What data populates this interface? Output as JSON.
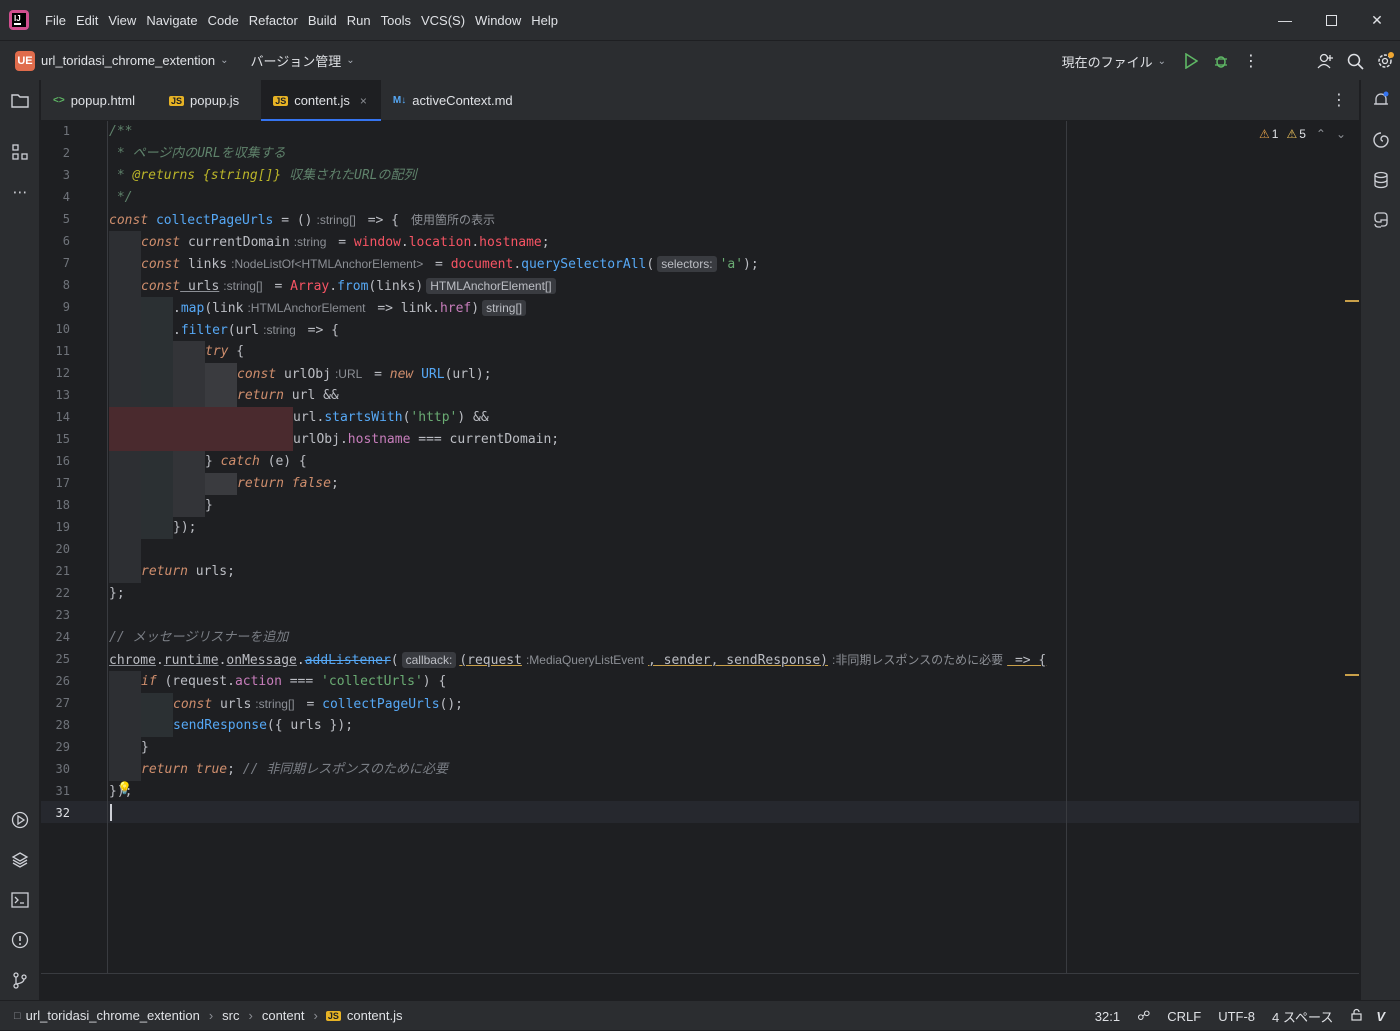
{
  "menu": [
    "File",
    "Edit",
    "View",
    "Navigate",
    "Code",
    "Refactor",
    "Build",
    "Run",
    "Tools",
    "VCS(S)",
    "Window",
    "Help"
  ],
  "toolbar": {
    "project_badge": "UE",
    "project_name": "url_toridasi_chrome_extention",
    "vcs_label": "バージョン管理",
    "run_config": "現在のファイル"
  },
  "tabs": [
    {
      "icon": "<>",
      "label": "popup.html"
    },
    {
      "icon": "JS",
      "label": "popup.js"
    },
    {
      "icon": "JS",
      "label": "content.js",
      "close": "×"
    },
    {
      "icon": "M↓",
      "label": "activeContext.md"
    }
  ],
  "inspections": {
    "errors": "1",
    "warnings": "5"
  },
  "code": {
    "l1": "/**",
    "l2": " * ページ内のURLを収集する",
    "l3_prefix": " * ",
    "l3_tag": "@returns",
    "l3_type": " {string[]}",
    "l3_text": " 収集されたURLの配列",
    "l4": " */",
    "l5_kw": "const",
    "l5_fn": "collectPageUrls",
    "l5_eq": " = ()",
    "l5_hint": ":string[]",
    "l5_arrow": " => {",
    "l5_usages": "使用箇所の表示",
    "l6_kw": "const",
    "l6_id": " currentDomain",
    "l6_hint": ":string",
    "l6_eq": " = ",
    "l6_window": "window",
    "l6_dot1": ".",
    "l6_loc": "location",
    "l6_dot2": ".",
    "l6_host": "hostname",
    "l6_end": ";",
    "l7_kw": "const",
    "l7_id": " links",
    "l7_hint": ":NodeListOf<HTMLAnchorElement>",
    "l7_eq": " = ",
    "l7_doc": "document",
    "l7_dot": ".",
    "l7_fn": "querySelectorAll",
    "l7_open": "(",
    "l7_param": "selectors:",
    "l7_arg": "'a'",
    "l7_end": ");",
    "l8_kw": "const",
    "l8_id": " urls",
    "l8_hint": ":string[]",
    "l8_eq": " = ",
    "l8_arr": "Array",
    "l8_dot": ".",
    "l8_fn": "from",
    "l8_args": "(links)",
    "l8_box": "HTMLAnchorElement[]",
    "l9_dot": ".",
    "l9_fn": "map",
    "l9_open": "(link",
    "l9_hint": ":HTMLAnchorElement",
    "l9_arrow": " => link.",
    "l9_prop": "href",
    "l9_close": ")",
    "l9_box": "string[]",
    "l10_dot": ".",
    "l10_fn": "filter",
    "l10_open": "(url",
    "l10_hint": ":string",
    "l10_arrow": " => {",
    "l11_kw": "try",
    "l11_rest": " {",
    "l12_kw": "const",
    "l12_id": " urlObj",
    "l12_hint": ":URL",
    "l12_eq": " = ",
    "l12_new": "new",
    "l12_cls": " URL",
    "l12_end": "(url);",
    "l13_kw": "return",
    "l13_rest": " url &&",
    "l14_id": "url.",
    "l14_fn": "startsWith",
    "l14_open": "(",
    "l14_str": "'http'",
    "l14_end": ") &&",
    "l15_id": "urlObj.",
    "l15_prop": "hostname",
    "l15_rest": " === currentDomain;",
    "l16_open": "} ",
    "l16_kw": "catch",
    "l16_rest": " (e) {",
    "l17_kw": "return",
    "l17_val": " false",
    "l17_end": ";",
    "l18": "}",
    "l19": "});",
    "l21_kw": "return",
    "l21_rest": " urls;",
    "l22": "};",
    "l24": "// メッセージリスナーを追加",
    "l25_a": "chrome",
    "l25_b": ".",
    "l25_c": "runtime",
    "l25_d": ".",
    "l25_e": "onMessage",
    "l25_f": ".",
    "l25_g": "addListener",
    "l25_h": "(",
    "l25_param": "callback:",
    "l25_i": "(request",
    "l25_hint1": ":MediaQueryListEvent",
    "l25_j": ", sender, sendResponse)",
    "l25_hint2": ":非同期レスポンスのために必要",
    "l25_k": " => {",
    "l26_kw": "if",
    "l26_a": " (request.",
    "l26_prop": "action",
    "l26_b": " === ",
    "l26_str": "'collectUrls'",
    "l26_c": ") {",
    "l27_kw": "const",
    "l27_id": " urls",
    "l27_hint": ":string[]",
    "l27_eq": " = ",
    "l27_fn": "collectPageUrls",
    "l27_end": "();",
    "l28_fn": "sendResponse",
    "l28_rest": "({ urls });",
    "l29": "}",
    "l30_kw": "return",
    "l30_val": " true",
    "l30_end": "; ",
    "l30_cm": "// 非同期レスポンスのために必要",
    "l31": "});",
    "bulb": "💡"
  },
  "breadcrumb": [
    "url_toridasi_chrome_extention",
    "src",
    "content",
    "content.js"
  ],
  "status": {
    "position": "32:1",
    "line_sep": "CRLF",
    "encoding": "UTF-8",
    "indent": "4 スペース"
  },
  "colors": {
    "accent": "#3574f0",
    "warning": "#f2c55c",
    "bg": "#1e1f22",
    "panel": "#2b2d30"
  }
}
